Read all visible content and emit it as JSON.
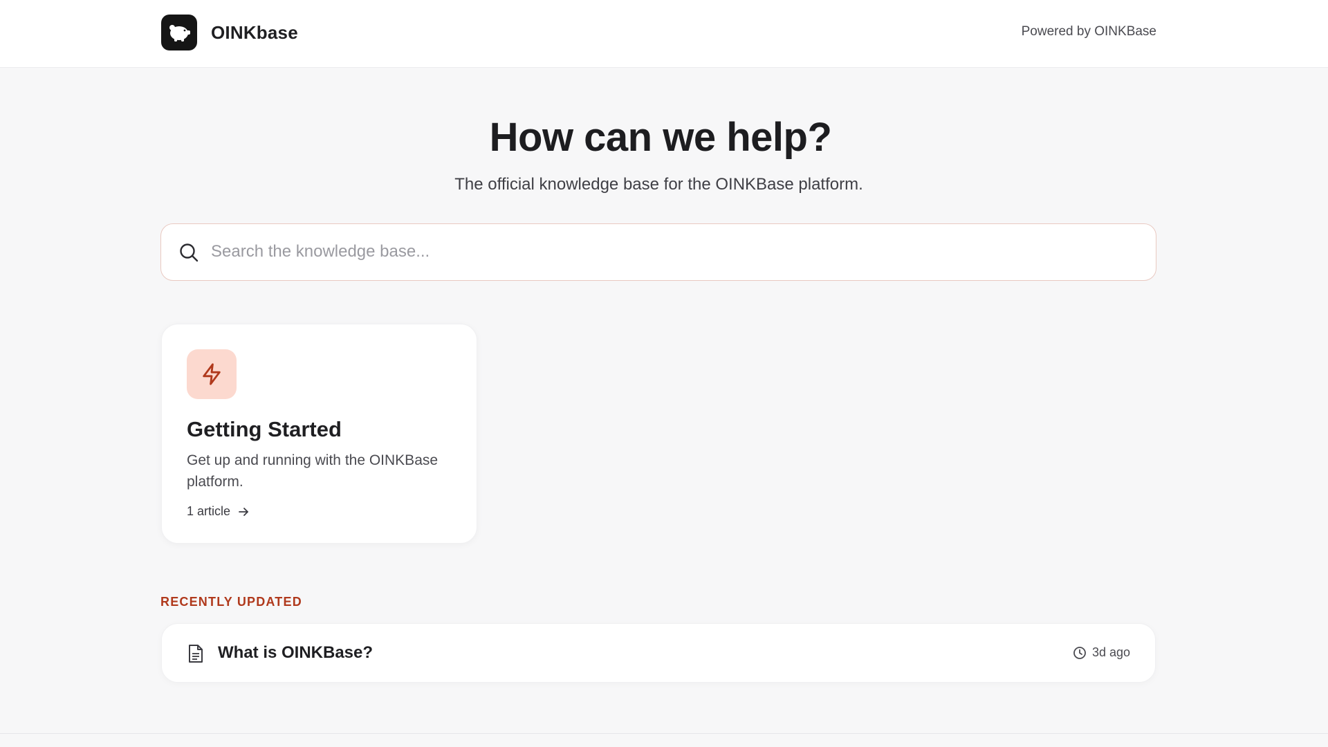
{
  "header": {
    "brand_name": "OINKbase",
    "powered_by": "Powered by OINKBase"
  },
  "hero": {
    "title": "How can we help?",
    "subtitle": "The official knowledge base for the OINKBase platform."
  },
  "search": {
    "placeholder": "Search the knowledge base..."
  },
  "categories": [
    {
      "icon": "lightning-icon",
      "title": "Getting Started",
      "description": "Get up and running with the OINKBase platform.",
      "article_count": "1 article"
    }
  ],
  "recent": {
    "label": "RECENTLY UPDATED",
    "articles": [
      {
        "title": "What is OINKBase?",
        "updated": "3d ago"
      }
    ]
  },
  "colors": {
    "accent": "#b0391c",
    "icon_bg": "#fcd9cf",
    "search_border": "#e9c9c1"
  }
}
